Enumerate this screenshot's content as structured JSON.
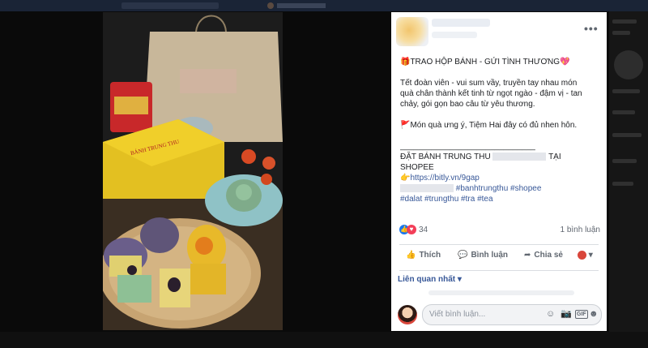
{
  "post": {
    "more_icon": "•••",
    "title_line": "TRAO HỘP BÁNH - GỬI TÌNH THƯƠNG",
    "para1": [
      "Tết đoàn viên - vui sum vầy, truyền tay nhau món",
      "quà chân thành kết tinh từ ngọt ngào - đậm vị - tan",
      "chảy, gói gọn bao câu từ yêu thương."
    ],
    "gift_line": "Món quà ưng ý, Tiệm Hai đây có đủ nhen hôn.",
    "divider": "______________________________",
    "order_line_start": "ĐẶT BÁNH TRUNG THU",
    "order_line_end": "TẠI",
    "shopee": "SHOPEE",
    "link": "https://bitly.vn/9gap",
    "tags_line1": "#banhtrungthu #shopee",
    "tags_line2": "#dalat #trungthu #tra #tea"
  },
  "reactions": {
    "count": "34",
    "comments": "1 bình luận"
  },
  "actions": {
    "like": "Thích",
    "comment": "Bình luận",
    "share": "Chia sẻ"
  },
  "related_label": "Liên quan nhất",
  "composer": {
    "placeholder": "Viết bình luận..."
  },
  "icons": [
    "gift-icon",
    "heart-icon",
    "flag-icon",
    "pointing-hand-icon",
    "like-icon",
    "love-icon",
    "thumbs-up-icon",
    "comment-icon",
    "share-icon",
    "emoji-icon",
    "camera-icon",
    "gif-icon",
    "sticker-icon"
  ],
  "colors": {
    "link": "#385898",
    "like_blue": "#1877f2",
    "love_red": "#f33e58"
  }
}
